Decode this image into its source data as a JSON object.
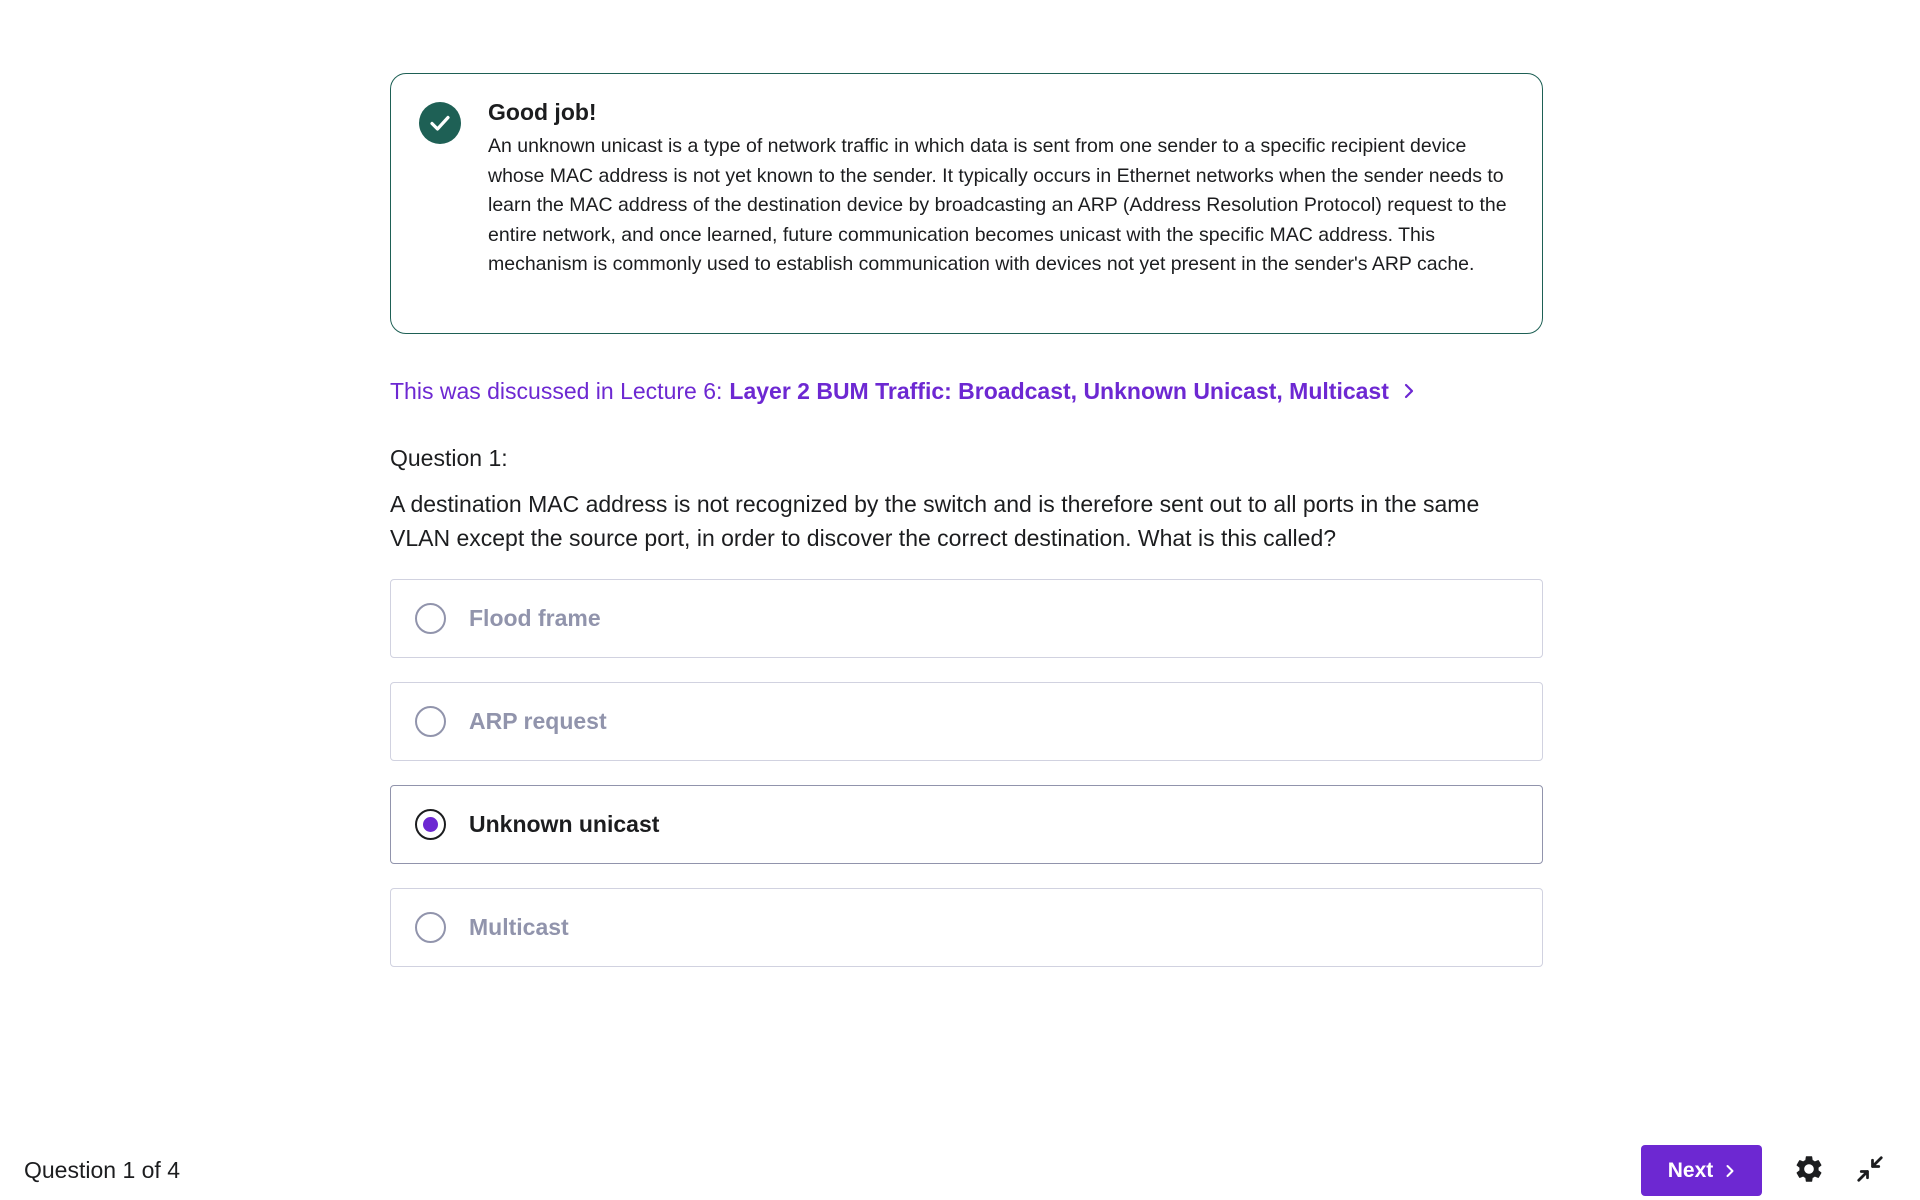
{
  "feedback": {
    "title": "Good job!",
    "body": "An unknown unicast is a type of network traffic in which data is sent from one sender to a specific recipient device whose MAC address is not yet known to the sender. It typically occurs in Ethernet networks when the sender needs to learn the MAC address of the destination device by broadcasting an ARP (Address Resolution Protocol) request to the entire network, and once learned, future communication becomes unicast with the specific MAC address. This mechanism is commonly used to establish communication with devices not yet present in the sender's ARP cache.",
    "status_icon": "check-circle-icon",
    "status_color": "#1e6055"
  },
  "lecture": {
    "prefix": "This was discussed in Lecture 6:",
    "title": "Layer 2 BUM Traffic: Broadcast, Unknown Unicast, Multicast"
  },
  "question": {
    "label": "Question 1:",
    "text": "A destination MAC address is not recognized by the switch and is therefore sent out to all ports in the same VLAN except the source port, in order to discover the correct destination. What is this called?",
    "options": [
      {
        "label": "Flood frame",
        "selected": false
      },
      {
        "label": "ARP request",
        "selected": false
      },
      {
        "label": "Unknown unicast",
        "selected": true
      },
      {
        "label": "Multicast",
        "selected": false
      }
    ]
  },
  "footer": {
    "progress": "Question 1 of 4",
    "next_label": "Next",
    "accent_color": "#6d28d2"
  }
}
